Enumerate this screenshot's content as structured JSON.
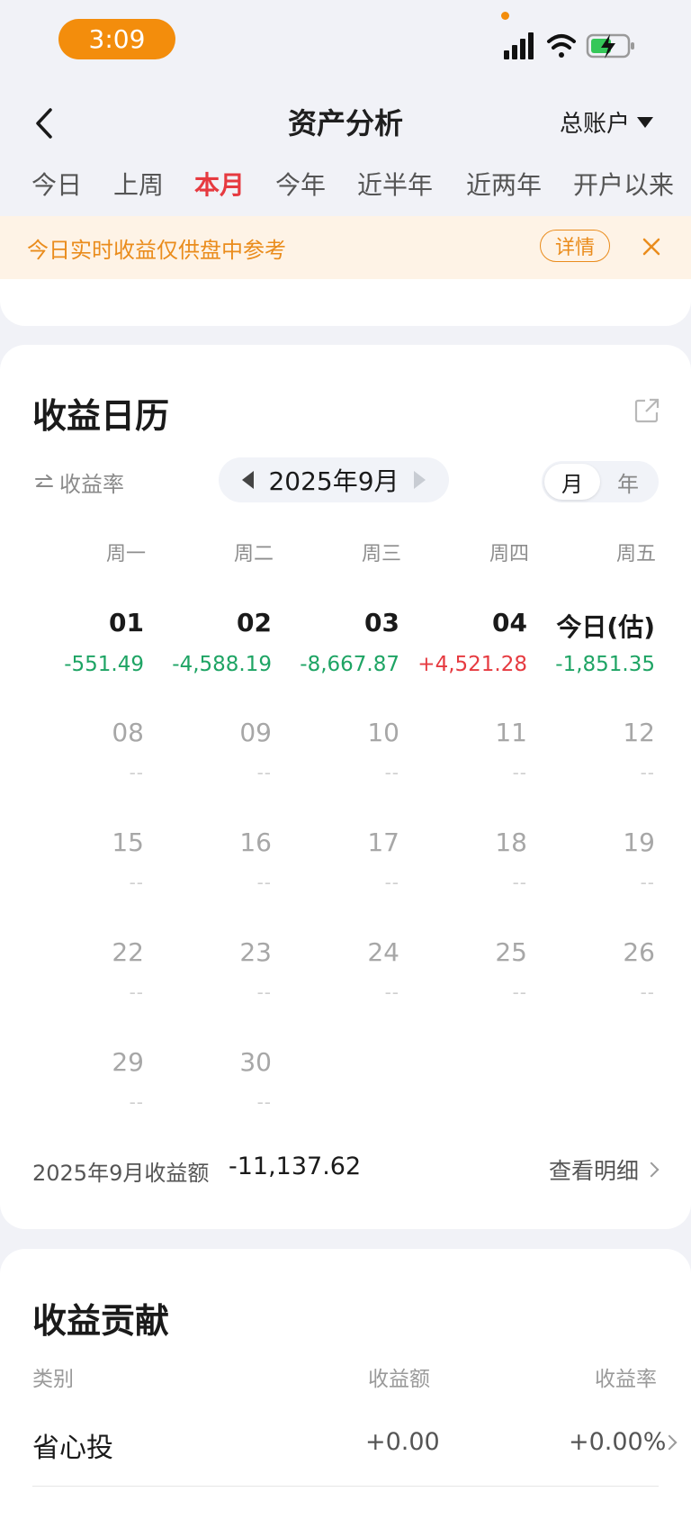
{
  "status_bar": {
    "time": "3:09",
    "icons": [
      "signal-icon",
      "wifi-icon",
      "battery-charging-icon"
    ]
  },
  "header": {
    "title": "资产分析",
    "account": "总账户"
  },
  "tabs": [
    {
      "label": "今日",
      "active": false
    },
    {
      "label": "上周",
      "active": false
    },
    {
      "label": "本月",
      "active": true
    },
    {
      "label": "今年",
      "active": false
    },
    {
      "label": "近半年",
      "active": false
    },
    {
      "label": "近两年",
      "active": false
    },
    {
      "label": "开户以来",
      "active": false
    }
  ],
  "banner": {
    "text": "今日实时收益仅供盘中参考",
    "detail": "详情"
  },
  "calendar": {
    "title": "收益日历",
    "rate_toggle": "收益率",
    "month": "2025年9月",
    "view_options": [
      {
        "label": "月",
        "active": true
      },
      {
        "label": "年",
        "active": false
      }
    ],
    "weekdays": [
      "周一",
      "周二",
      "周三",
      "周四",
      "周五"
    ],
    "weeks": [
      [
        {
          "day": "01",
          "value": "-551.49",
          "kind": "neg"
        },
        {
          "day": "02",
          "value": "-4,588.19",
          "kind": "neg"
        },
        {
          "day": "03",
          "value": "-8,667.87",
          "kind": "neg"
        },
        {
          "day": "04",
          "value": "+4,521.28",
          "kind": "pos"
        },
        {
          "day": "今日(估)",
          "value": "-1,851.35",
          "kind": "neg"
        }
      ],
      [
        {
          "day": "08",
          "value": "--",
          "kind": "none"
        },
        {
          "day": "09",
          "value": "--",
          "kind": "none"
        },
        {
          "day": "10",
          "value": "--",
          "kind": "none"
        },
        {
          "day": "11",
          "value": "--",
          "kind": "none"
        },
        {
          "day": "12",
          "value": "--",
          "kind": "none"
        }
      ],
      [
        {
          "day": "15",
          "value": "--",
          "kind": "none"
        },
        {
          "day": "16",
          "value": "--",
          "kind": "none"
        },
        {
          "day": "17",
          "value": "--",
          "kind": "none"
        },
        {
          "day": "18",
          "value": "--",
          "kind": "none"
        },
        {
          "day": "19",
          "value": "--",
          "kind": "none"
        }
      ],
      [
        {
          "day": "22",
          "value": "--",
          "kind": "none"
        },
        {
          "day": "23",
          "value": "--",
          "kind": "none"
        },
        {
          "day": "24",
          "value": "--",
          "kind": "none"
        },
        {
          "day": "25",
          "value": "--",
          "kind": "none"
        },
        {
          "day": "26",
          "value": "--",
          "kind": "none"
        }
      ],
      [
        {
          "day": "29",
          "value": "--",
          "kind": "none"
        },
        {
          "day": "30",
          "value": "--",
          "kind": "none"
        }
      ]
    ],
    "summary_label": "2025年9月收益额",
    "summary_value": "-11,137.62",
    "view_detail": "查看明细"
  },
  "contribution": {
    "title": "收益贡献",
    "headers": {
      "category": "类别",
      "amount": "收益额",
      "rate": "收益率"
    },
    "rows": [
      {
        "category": "省心投",
        "amount": "+0.00",
        "rate": "+0.00%"
      }
    ]
  }
}
